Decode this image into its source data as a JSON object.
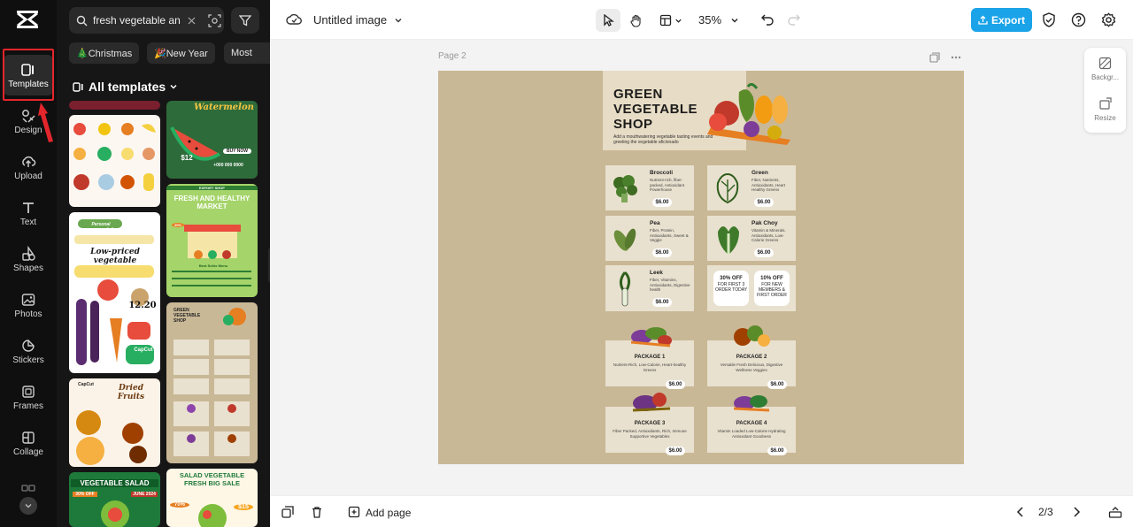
{
  "rail": {
    "items": [
      {
        "label": "Templates",
        "icon": "templates-icon"
      },
      {
        "label": "Design",
        "icon": "design-icon"
      },
      {
        "label": "Upload",
        "icon": "upload-icon"
      },
      {
        "label": "Text",
        "icon": "text-icon"
      },
      {
        "label": "Shapes",
        "icon": "shapes-icon"
      },
      {
        "label": "Photos",
        "icon": "photos-icon"
      },
      {
        "label": "Stickers",
        "icon": "stickers-icon"
      },
      {
        "label": "Frames",
        "icon": "frames-icon"
      },
      {
        "label": "Collage",
        "icon": "collage-icon"
      }
    ]
  },
  "panel": {
    "search_value": "fresh vegetable an",
    "chips": [
      "🎄Christmas",
      "🎉New Year",
      "Most"
    ],
    "all_templates": "All templates",
    "thumbs": {
      "watermelon": "Watermelon",
      "watermelon_price": "$12",
      "watermelon_phone": "+000 000 0000",
      "watermelon_buy": "BUY NOW",
      "market_title": "FRESH AND HEALTHY MARKET",
      "market_top": "EXPORT SHOP",
      "market_list": "Best Seller Menu",
      "market_badge": "20%",
      "fruit_name": "Low-priced vegetable",
      "veg_note": "Personal recommendation",
      "veg_price": "12.20",
      "veg_brand": "CapCut",
      "grid_title": "GREEN VEGETABLE SHOP",
      "dried": "Dried Fruits",
      "dried_brand": "CapCut",
      "salad": "VEGETABLE SALAD",
      "salad_badge": "30% OFF",
      "salad_date": "JUNE 2024",
      "sale_title": "SALAD VEGETABLE FRESH BIG SALE",
      "sale_pct": "70%",
      "sale_price": "$15"
    }
  },
  "topbar": {
    "title": "Untitled image",
    "zoom": "35%",
    "export": "Export"
  },
  "canvas": {
    "page_label": "Page 2",
    "side": {
      "background": "Backgr...",
      "resize": "Resize"
    }
  },
  "design": {
    "title": "GREEN VEGETABLE SHOP",
    "subtitle": "Add a mouthwatering vegetable tasting events and greeting the vegetable aficionado",
    "items": [
      {
        "name": "Broccoli",
        "desc": "Nutrient-rich, fiber-packed, Antioxidant Powerhouse",
        "price": "$6.00"
      },
      {
        "name": "Green",
        "desc": "Fiber, Nutrients, Antioxidants, Heart Healthy Greens",
        "price": "$6.00"
      },
      {
        "name": "Pea",
        "desc": "Fiber, Protein, Antioxidants, Sweet & Veggie",
        "price": "$6.00"
      },
      {
        "name": "Pak Choy",
        "desc": "Vitamin & Minerals, Antioxidants, Low-Calorie Greens",
        "price": "$6.00"
      },
      {
        "name": "Leek",
        "desc": "Fiber, Vitamins, Antioxidants, Digestive health",
        "price": "$6.00"
      }
    ],
    "coupons": [
      {
        "pct": "30% OFF",
        "text": "FOR FIRST 3 ORDER TODAY"
      },
      {
        "pct": "10% OFF",
        "text": "FOR NEW MEMBERS & FIRST ORDER"
      }
    ],
    "packages": [
      {
        "name": "PACKAGE 1",
        "desc": "Nutrient-Rich, Low-Calorie, Heart-healthy Greens",
        "price": "$6.00"
      },
      {
        "name": "PACKAGE 2",
        "desc": "Versatile Fresh Delicious, Digestive Wellness Veggies",
        "price": "$6.00"
      },
      {
        "name": "PACKAGE 3",
        "desc": "Fiber Packed, Antioxidants, Rich, Immune Supportive Vegetables",
        "price": "$6.00"
      },
      {
        "name": "PACKAGE 4",
        "desc": "Vitamin Loaded Low-Calorie Hydrating Antioxidant Goodness",
        "price": "$6.00"
      }
    ]
  },
  "bottombar": {
    "add_page": "Add page",
    "pager": "2/3"
  },
  "colors": {
    "accent": "#1aa3e8",
    "highlight": "#e3262c",
    "page_bg": "#c9b896"
  }
}
